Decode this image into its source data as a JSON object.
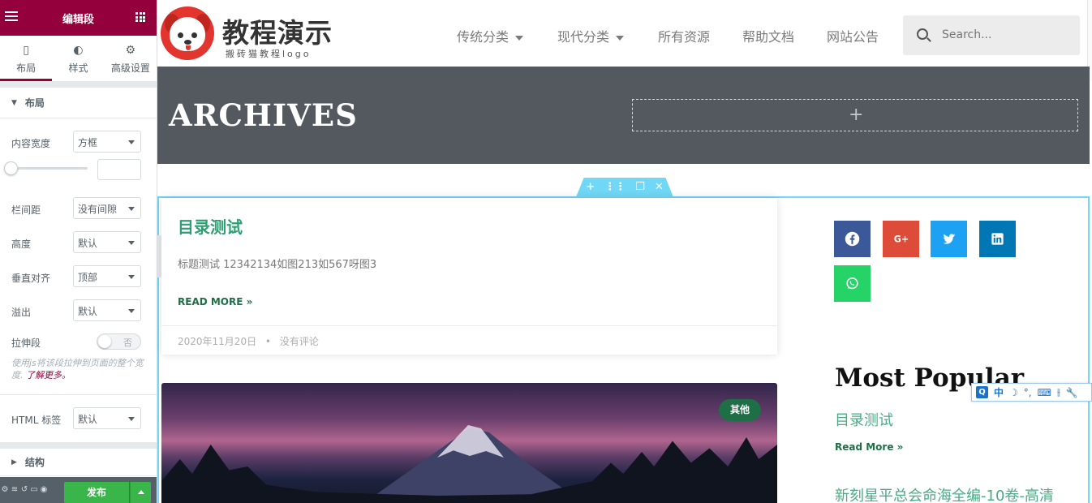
{
  "panel": {
    "title": "编辑段",
    "tabs": [
      {
        "label": "布局",
        "icon": "layout-icon",
        "active": true
      },
      {
        "label": "样式",
        "icon": "contrast-icon",
        "active": false
      },
      {
        "label": "高级设置",
        "icon": "gear-icon",
        "active": false
      }
    ],
    "section_layout": "布局",
    "controls": {
      "content_width": {
        "label": "内容宽度",
        "value": "方框"
      },
      "column_gap": {
        "label": "栏间距",
        "value": "没有间隙"
      },
      "height": {
        "label": "高度",
        "value": "默认"
      },
      "vertical_align": {
        "label": "垂直对齐",
        "value": "顶部"
      },
      "overflow": {
        "label": "溢出",
        "value": "默认"
      },
      "stretch": {
        "label": "拉伸段",
        "value": "否"
      },
      "stretch_help": "使用js将该段拉伸到页面的整个宽度.",
      "stretch_help_link": "了解更多。",
      "html_tag": {
        "label": "HTML 标签",
        "value": "默认"
      }
    },
    "section_structure": "结构",
    "footer": {
      "publish_label": "发布"
    }
  },
  "site": {
    "logo_title": "教程演示",
    "logo_subtitle": "搬砖猫教程logo",
    "nav": [
      {
        "label": "传统分类",
        "dropdown": true
      },
      {
        "label": "现代分类",
        "dropdown": true
      },
      {
        "label": "所有资源",
        "dropdown": false
      },
      {
        "label": "帮助文档",
        "dropdown": false
      },
      {
        "label": "网站公告",
        "dropdown": false
      }
    ],
    "search_placeholder": "Search..."
  },
  "archives": {
    "title": "ARCHIVES",
    "add_symbol": "+"
  },
  "section_handle": {
    "add": "+",
    "move": "⋮⋮",
    "duplicate": "❐",
    "close": "✕"
  },
  "post": {
    "title": "目录测试",
    "excerpt": "标题测试 12342134如图213如567呀图3",
    "read_more": "READ MORE »",
    "date": "2020年11月20日",
    "separator": "•",
    "comments": "没有评论"
  },
  "image_post": {
    "badge": "其他"
  },
  "share": {
    "buttons": [
      {
        "name": "facebook",
        "color": "#3b5998"
      },
      {
        "name": "google-plus",
        "color": "#dd4b39"
      },
      {
        "name": "twitter",
        "color": "#1da1f2"
      },
      {
        "name": "linkedin",
        "color": "#0077b5"
      },
      {
        "name": "whatsapp",
        "color": "#25d366"
      }
    ]
  },
  "most_popular": {
    "title": "Most Popular",
    "items": [
      {
        "title": "目录测试",
        "read_more": "Read More »"
      },
      {
        "title": "新刻星平总会命海全编-10卷-高清"
      }
    ]
  },
  "ime": {
    "logo": "Q",
    "lang": "中",
    "moon": "☽",
    "punct": "°,",
    "keyboard": "⌨",
    "extra": "⫲",
    "tool": "🔧"
  },
  "colors": {
    "brand": "#93003c",
    "accent": "#2f9e74",
    "banner": "#54595f",
    "publish": "#39b54a",
    "selection": "#71d7f7"
  }
}
